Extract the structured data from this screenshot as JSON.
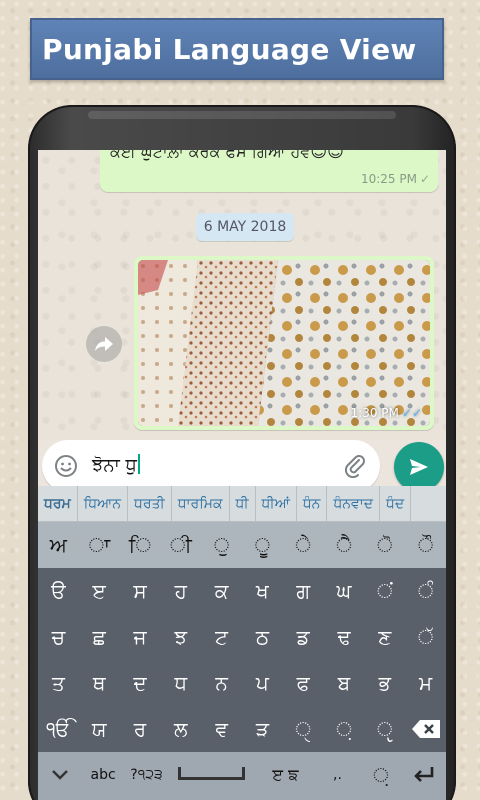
{
  "banner": {
    "title": "Punjabi Language View"
  },
  "chat": {
    "outgoing_text": "ਕਈ ਘੁਟਾਲ਼ਾ ਕਰਕ ਫਸ ਗਿਆ ਹਵ😊😊",
    "outgoing_time": "10:25 PM",
    "date_separator": "6 MAY 2018",
    "image_time": "1:30 PM"
  },
  "composer": {
    "text": "ਝੋਨਾ ਧੁ"
  },
  "keyboard": {
    "suggestions": [
      "ਧਰਮ",
      "ਧਿਆਨ",
      "ਧਰਤੀ",
      "ਧਾਰਮਿਕ",
      "ਧੀ",
      "ਧੀਆਂ",
      "ਧੰਨ",
      "ਧੰਨਵਾਦ",
      "ਧੰਦ"
    ],
    "row1": [
      "ਅ",
      "ਾ",
      "ਿ",
      "ੀ",
      "ੁ",
      "ੂ",
      "ੇ",
      "ੈ",
      "ੋ",
      "ੌ"
    ],
    "row2": [
      "ੳ",
      "ੲ",
      "ਸ",
      "ਹ",
      "ਕ",
      "ਖ",
      "ਗ",
      "ਘ",
      "ਂ",
      "ੰ"
    ],
    "row3": [
      "ਚ",
      "ਛ",
      "ਜ",
      "ਝ",
      "ਟ",
      "ਠ",
      "ਡ",
      "ਢ",
      "ਣ",
      "ੱ"
    ],
    "row4": [
      "ਤ",
      "ਥ",
      "ਦ",
      "ਧ",
      "ਨ",
      "ਪ",
      "ਫ",
      "ਬ",
      "ਭ",
      "ਮ"
    ],
    "row5": [
      "ੴ",
      "ਯ",
      "ਰ",
      "ਲ",
      "ਵ",
      "ੜ",
      "ੑ",
      "਼",
      "ੵ"
    ],
    "abc_label": "abc",
    "num_label": "?੧੨੩",
    "lang_label": "ੲ ਙ",
    "comma_label": ",.",
    "nukta_label": "਼"
  },
  "colors": {
    "banner": "#5a7fb3",
    "bubble_out": "#dcf8c6",
    "send": "#1c9d88",
    "suggest_text": "#2a6ea0"
  }
}
